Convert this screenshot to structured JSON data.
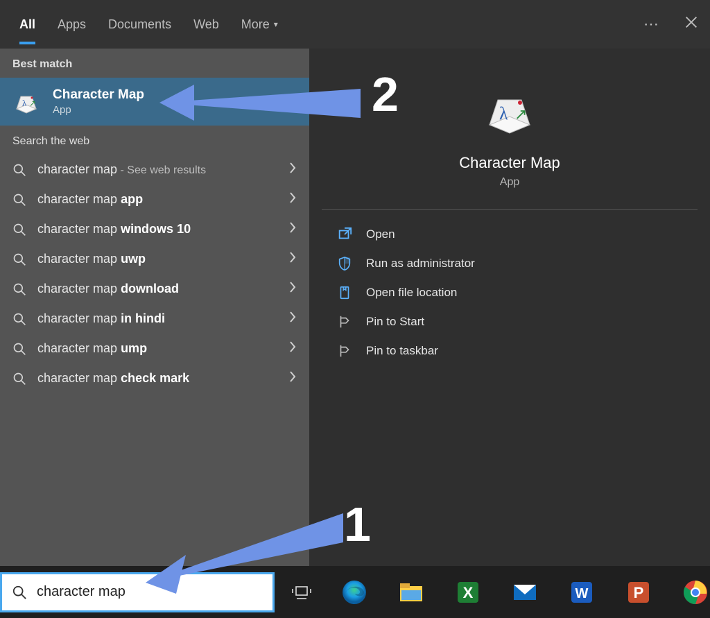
{
  "tabs": {
    "all": "All",
    "apps": "Apps",
    "documents": "Documents",
    "web": "Web",
    "more": "More"
  },
  "sections": {
    "best_match": "Best match",
    "search_web": "Search the web"
  },
  "best_match": {
    "title": "Character Map",
    "subtitle": "App"
  },
  "web_results": [
    {
      "prefix": "character map",
      "bold": "",
      "aux": " - See web results"
    },
    {
      "prefix": "character map ",
      "bold": "app",
      "aux": ""
    },
    {
      "prefix": "character map ",
      "bold": "windows 10",
      "aux": ""
    },
    {
      "prefix": "character map ",
      "bold": "uwp",
      "aux": ""
    },
    {
      "prefix": "character map ",
      "bold": "download",
      "aux": ""
    },
    {
      "prefix": "character map ",
      "bold": "in hindi",
      "aux": ""
    },
    {
      "prefix": "character map ",
      "bold": "ump",
      "aux": ""
    },
    {
      "prefix": "character map ",
      "bold": "check mark",
      "aux": ""
    }
  ],
  "detail": {
    "title": "Character Map",
    "subtitle": "App",
    "actions": {
      "open": "Open",
      "admin": "Run as administrator",
      "file_loc": "Open file location",
      "pin_start": "Pin to Start",
      "pin_taskbar": "Pin to taskbar"
    }
  },
  "search": {
    "value": "character map"
  },
  "annotations": {
    "step1": "1",
    "step2": "2"
  },
  "taskbar_app_names": [
    "task-view",
    "edge",
    "file-explorer",
    "excel",
    "mail",
    "word",
    "powerpoint",
    "chrome"
  ]
}
